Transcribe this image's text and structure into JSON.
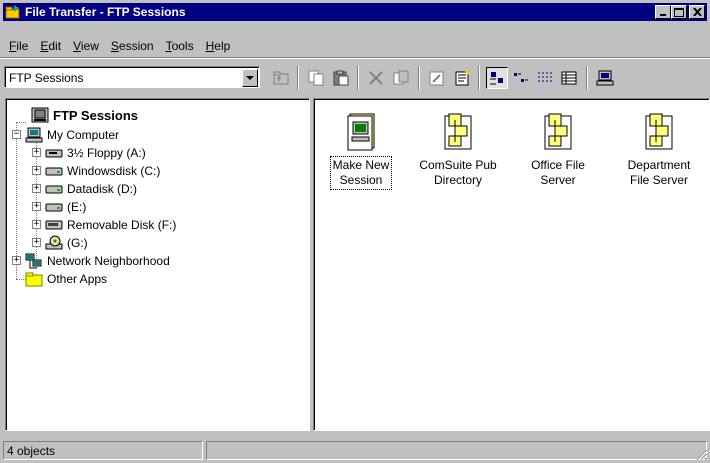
{
  "window": {
    "title": "File Transfer - FTP Sessions",
    "controls": {
      "minimize": "_",
      "maximize": "□",
      "close": "x"
    }
  },
  "menu": [
    {
      "label": "File",
      "accel": "F",
      "rest": "ile"
    },
    {
      "label": "Edit",
      "accel": "E",
      "rest": "dit"
    },
    {
      "label": "View",
      "accel": "V",
      "rest": "iew"
    },
    {
      "label": "Session",
      "accel": "S",
      "rest": "ession"
    },
    {
      "label": "Tools",
      "accel": "T",
      "rest": "ools"
    },
    {
      "label": "Help",
      "accel": "H",
      "rest": "elp"
    }
  ],
  "toolbar": {
    "location_value": "FTP Sessions",
    "buttons": [
      "up-folder",
      "cut",
      "copy",
      "paste",
      "delete",
      "copy-to",
      "properties",
      "new-session",
      "large-icons",
      "small-icons",
      "list",
      "details",
      "connect"
    ]
  },
  "tree": {
    "root": "FTP Sessions",
    "my_computer": "My Computer",
    "drives": [
      "3½ Floppy (A:)",
      "Windowsdisk (C:)",
      "Datadisk (D:)",
      "(E:)",
      "Removable Disk (F:)",
      "(G:)"
    ],
    "network": "Network Neighborhood",
    "other": "Other Apps"
  },
  "items": [
    {
      "line1": "Make New",
      "line2": "Session",
      "icon": "new-session-icon"
    },
    {
      "line1": "ComSuite Pub",
      "line2": "Directory",
      "icon": "ftp-server-icon"
    },
    {
      "line1": "Office File",
      "line2": "Server",
      "icon": "ftp-server-icon"
    },
    {
      "line1": "Department",
      "line2": "File Server",
      "icon": "ftp-server-icon"
    }
  ],
  "status": {
    "count_text": "4 objects",
    "second_text": ""
  },
  "colors": {
    "titlebar": "#000080",
    "face": "#c0c0c0",
    "folder": "#ffff00",
    "screen": "#008000"
  }
}
